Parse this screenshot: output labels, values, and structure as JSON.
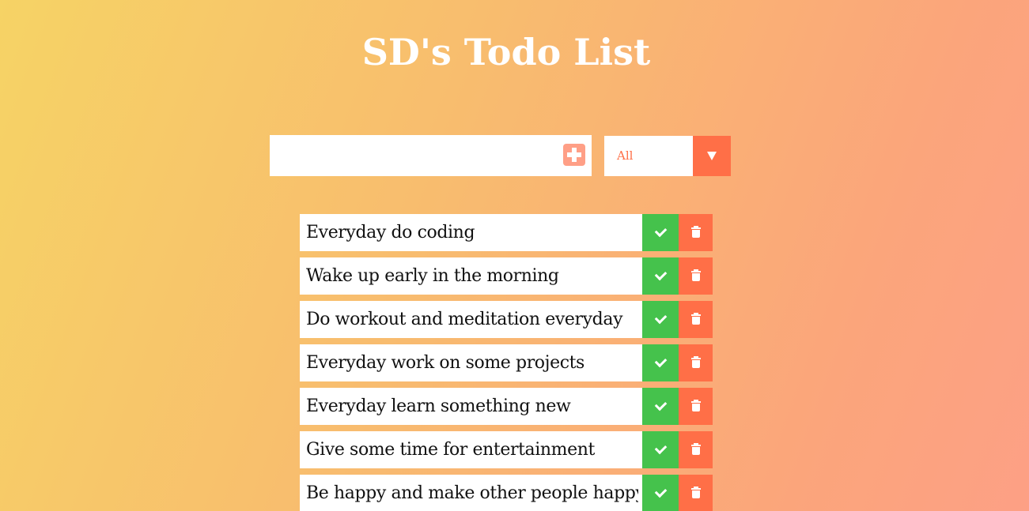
{
  "app": {
    "title": "SD's Todo List"
  },
  "form": {
    "input_value": "",
    "add_icon": "plus-square-icon",
    "filter": {
      "selected": "All",
      "arrow_icon": "caret-down-icon"
    }
  },
  "todos": [
    {
      "text": "Everyday do coding"
    },
    {
      "text": "Wake up early in the morning"
    },
    {
      "text": "Do workout and meditation everyday"
    },
    {
      "text": "Everyday work on some projects"
    },
    {
      "text": "Everyday learn something new"
    },
    {
      "text": "Give some time for entertainment"
    },
    {
      "text": "Be happy and make other people happy"
    }
  ],
  "icons": {
    "complete": "check-icon",
    "delete": "trash-icon"
  },
  "colors": {
    "gradient_start": "#f6d365",
    "gradient_end": "#fda085",
    "accent": "#ff6f47",
    "add_button": "#ff9f86",
    "complete": "#45c24c",
    "title_text": "#ffffff"
  }
}
